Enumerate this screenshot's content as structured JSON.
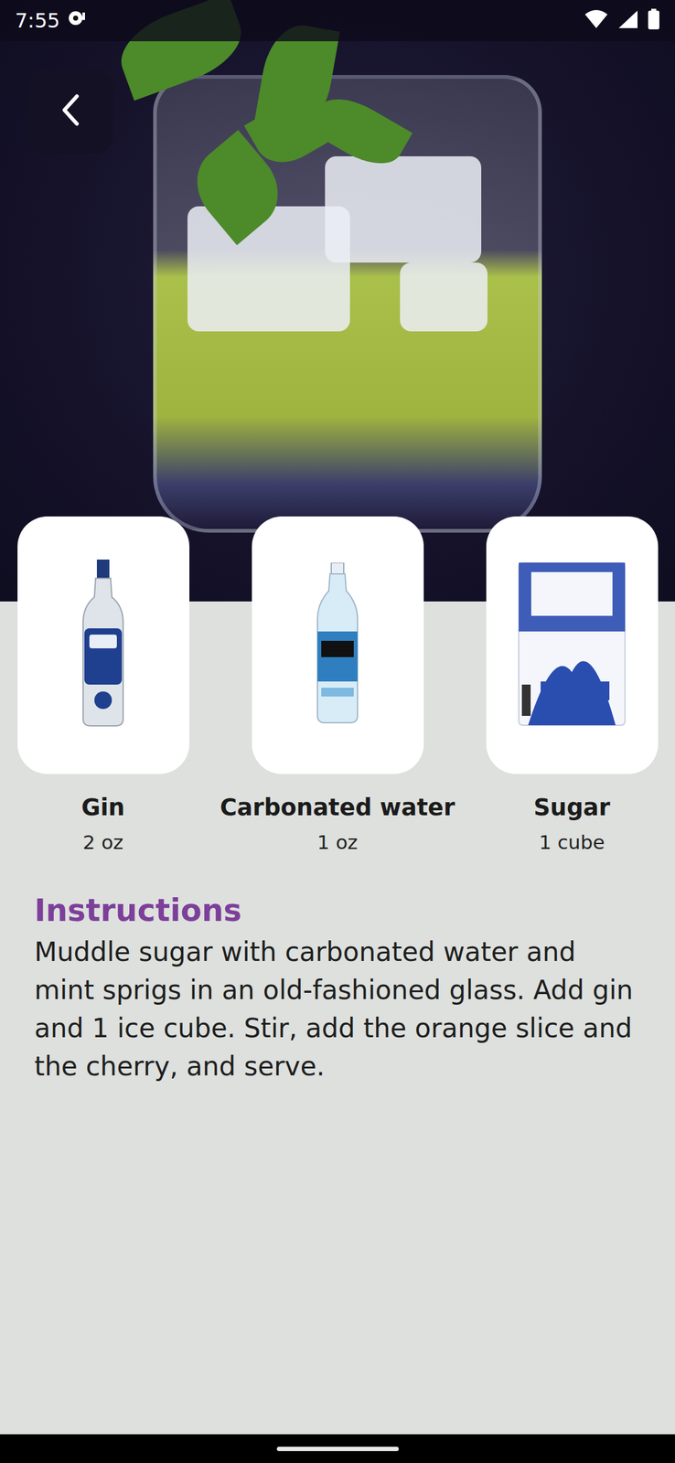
{
  "status_bar": {
    "time": "7:55"
  },
  "ingredients": [
    {
      "name": "Gin",
      "amount": "2 oz",
      "kind": "liquor"
    },
    {
      "name": "Carbonated water",
      "amount": "1 oz",
      "kind": "soda"
    },
    {
      "name": "Sugar",
      "amount": "1 cube",
      "kind": "sugar"
    }
  ],
  "instructions": {
    "title": "Instructions",
    "text": "Muddle sugar with carbonated water and mint sprigs in an old-fashioned glass. Add gin and 1 ice cube. Stir, add the orange slice and the cherry, and serve."
  }
}
